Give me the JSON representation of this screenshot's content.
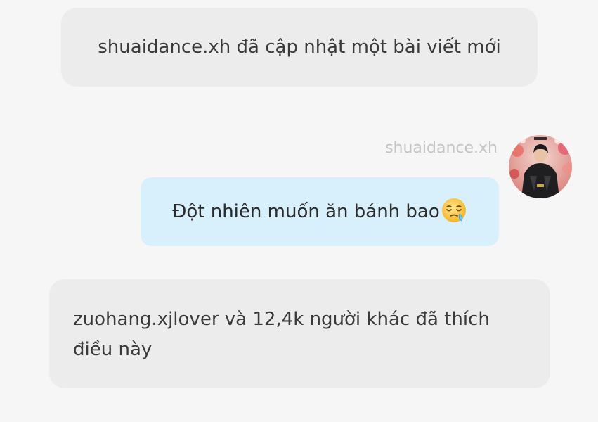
{
  "system_notice": {
    "text": "shuaidance.xh đã cập nhật một bài viết mới"
  },
  "message": {
    "sender": "shuaidance.xh",
    "text": "Đột nhiên muốn ăn bánh bao",
    "emoji": "sleepy-face-emoji",
    "bubble_color": "#d8f0fb"
  },
  "likes_notice": {
    "text": "zuohang.xjlover và 12,4k người khác đã thích điều này"
  },
  "colors": {
    "background": "#f6f6f6",
    "notice_bg": "#ececec",
    "sender_name": "#c4c4c4"
  }
}
